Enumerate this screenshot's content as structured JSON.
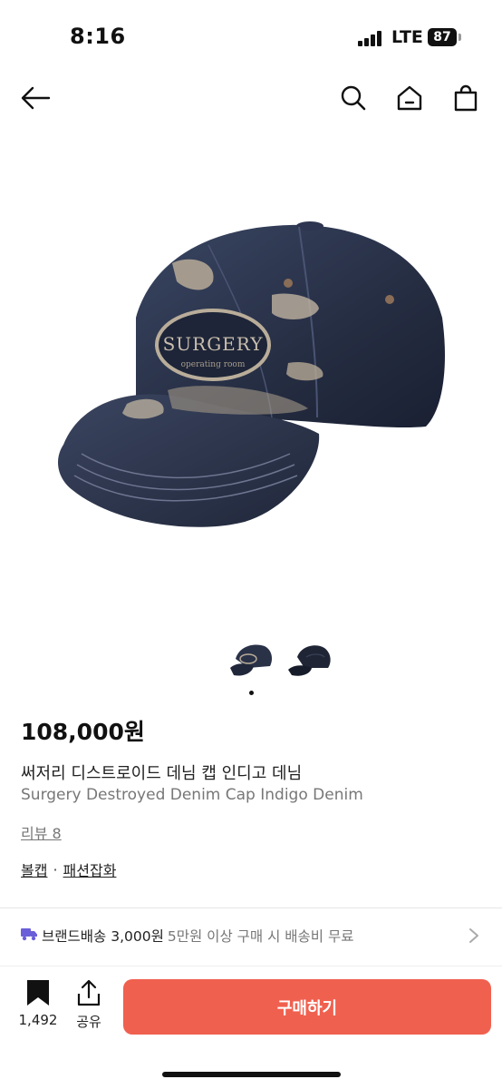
{
  "status_bar": {
    "time": "8:16",
    "network": "LTE",
    "battery": "87"
  },
  "nav": {
    "back_icon": "arrow-left-icon",
    "search_icon": "search-icon",
    "home_icon": "home-icon",
    "bag_icon": "shopping-bag-icon"
  },
  "product": {
    "price": "108,000원",
    "name_kr": "써저리 디스트로이드 데님 캡 인디고 데님",
    "name_en": "Surgery Destroyed Denim Cap Indigo Denim",
    "reviews": "리뷰 8",
    "category": [
      "볼캡",
      "패션잡화"
    ],
    "category_separator": "·",
    "image_count": 2,
    "active_image": 1
  },
  "shipping": {
    "main": "브랜드배송 3,000원",
    "sub": "5만원 이상 구매 시 배송비 무료",
    "truck_color": "#6a5fd8"
  },
  "bottom_bar": {
    "wish_count": "1,492",
    "share_label": "공유",
    "buy_label": "구매하기",
    "buy_color": "#f0604f"
  }
}
